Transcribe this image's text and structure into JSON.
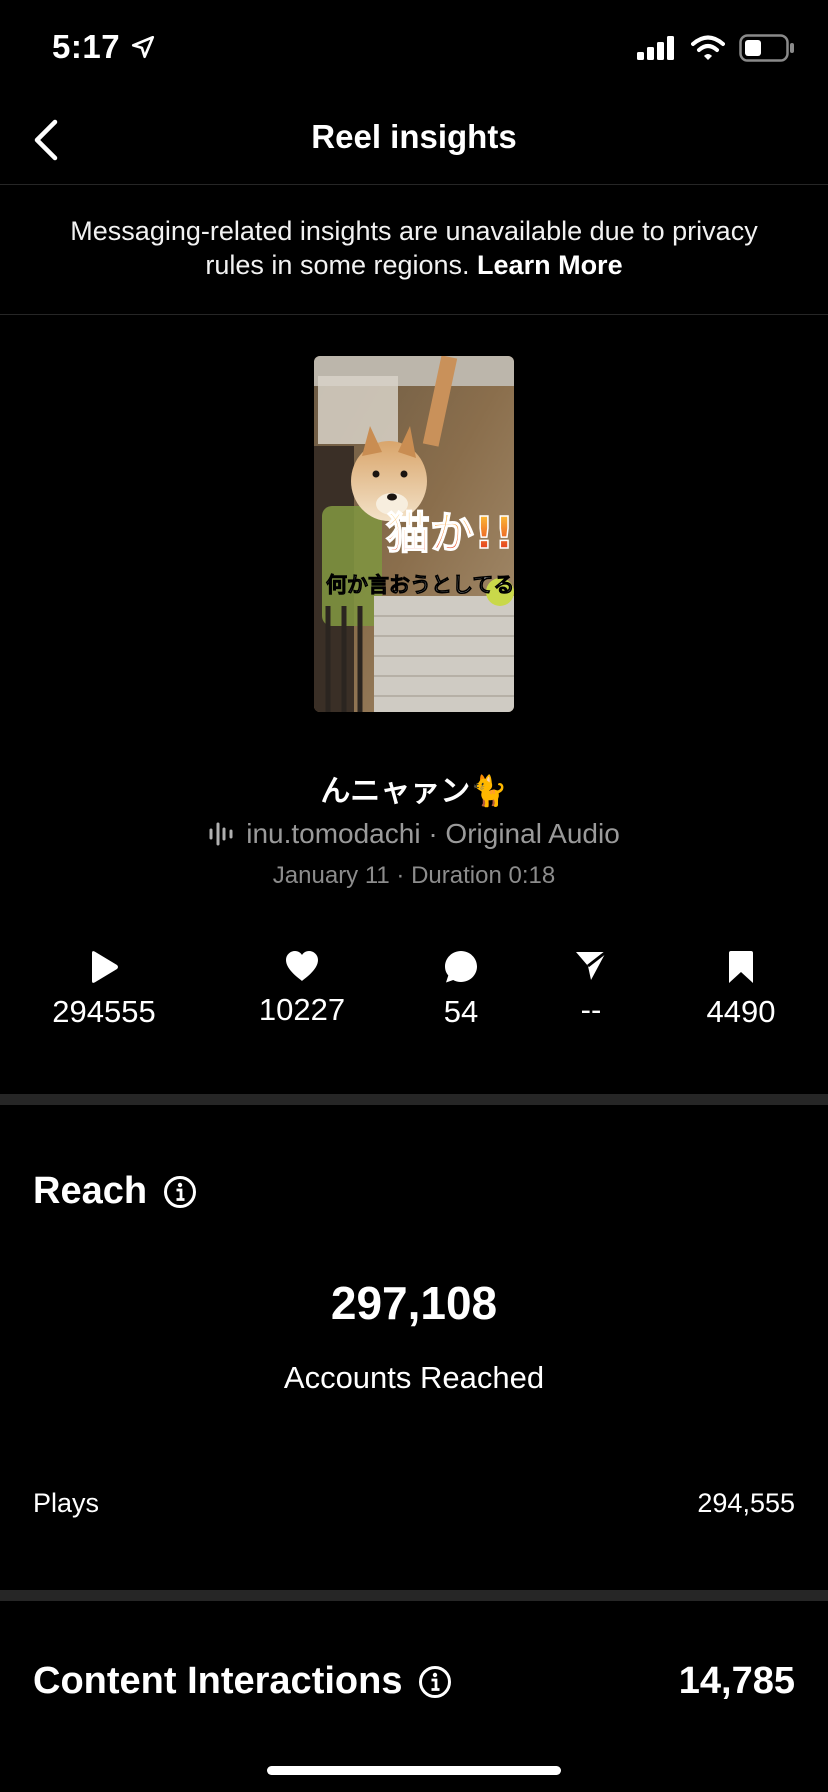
{
  "status": {
    "time": "5:17"
  },
  "header": {
    "title": "Reel insights"
  },
  "notice": {
    "text": "Messaging-related insights are unavailable due to privacy rules in some regions.",
    "link": "Learn More"
  },
  "reel": {
    "overlay_big": "猫か!!",
    "overlay_small": "何か言おうとしてる",
    "title": "んニャァン🐈",
    "audio": "inu.tomodachi · Original Audio",
    "meta": "January 11 · Duration 0:18"
  },
  "stats": {
    "plays": "294555",
    "likes": "10227",
    "comments": "54",
    "shares": "--",
    "saves": "4490"
  },
  "reach": {
    "heading": "Reach",
    "accounts": "297,108",
    "accounts_label": "Accounts Reached",
    "plays_label": "Plays",
    "plays_value": "294,555"
  },
  "interactions": {
    "heading": "Content Interactions",
    "value": "14,785"
  }
}
